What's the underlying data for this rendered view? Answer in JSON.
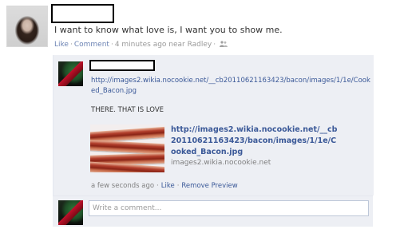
{
  "post": {
    "status_text": "I want to know what love is, I want you to show me.",
    "actions": {
      "like": "Like",
      "comment": "Comment",
      "time": "4 minutes ago near Radley",
      "separator": "·"
    },
    "privacy_icon": "friends-icon"
  },
  "comment": {
    "link_url": "http://images2.wikia.nocookie.net/__cb20110621163423/bacon/images/1/1e/Cooked_Bacon.jpg",
    "body": "THERE. THAT IS LOVE",
    "preview": {
      "title": "http://images2.wikia.nocookie.net/__cb20110621163423/bacon/images/1/1e/Cooked_Bacon.jpg",
      "domain": "images2.wikia.nocookie.net"
    },
    "meta": {
      "time": "a few seconds ago",
      "like": "Like",
      "remove_preview": "Remove Preview",
      "separator": "·"
    }
  },
  "composer": {
    "placeholder": "Write a comment..."
  },
  "colors": {
    "link": "#3b5998",
    "muted_link": "#6d84b4",
    "panel_bg": "#edeff4",
    "meta_text": "#999999"
  }
}
